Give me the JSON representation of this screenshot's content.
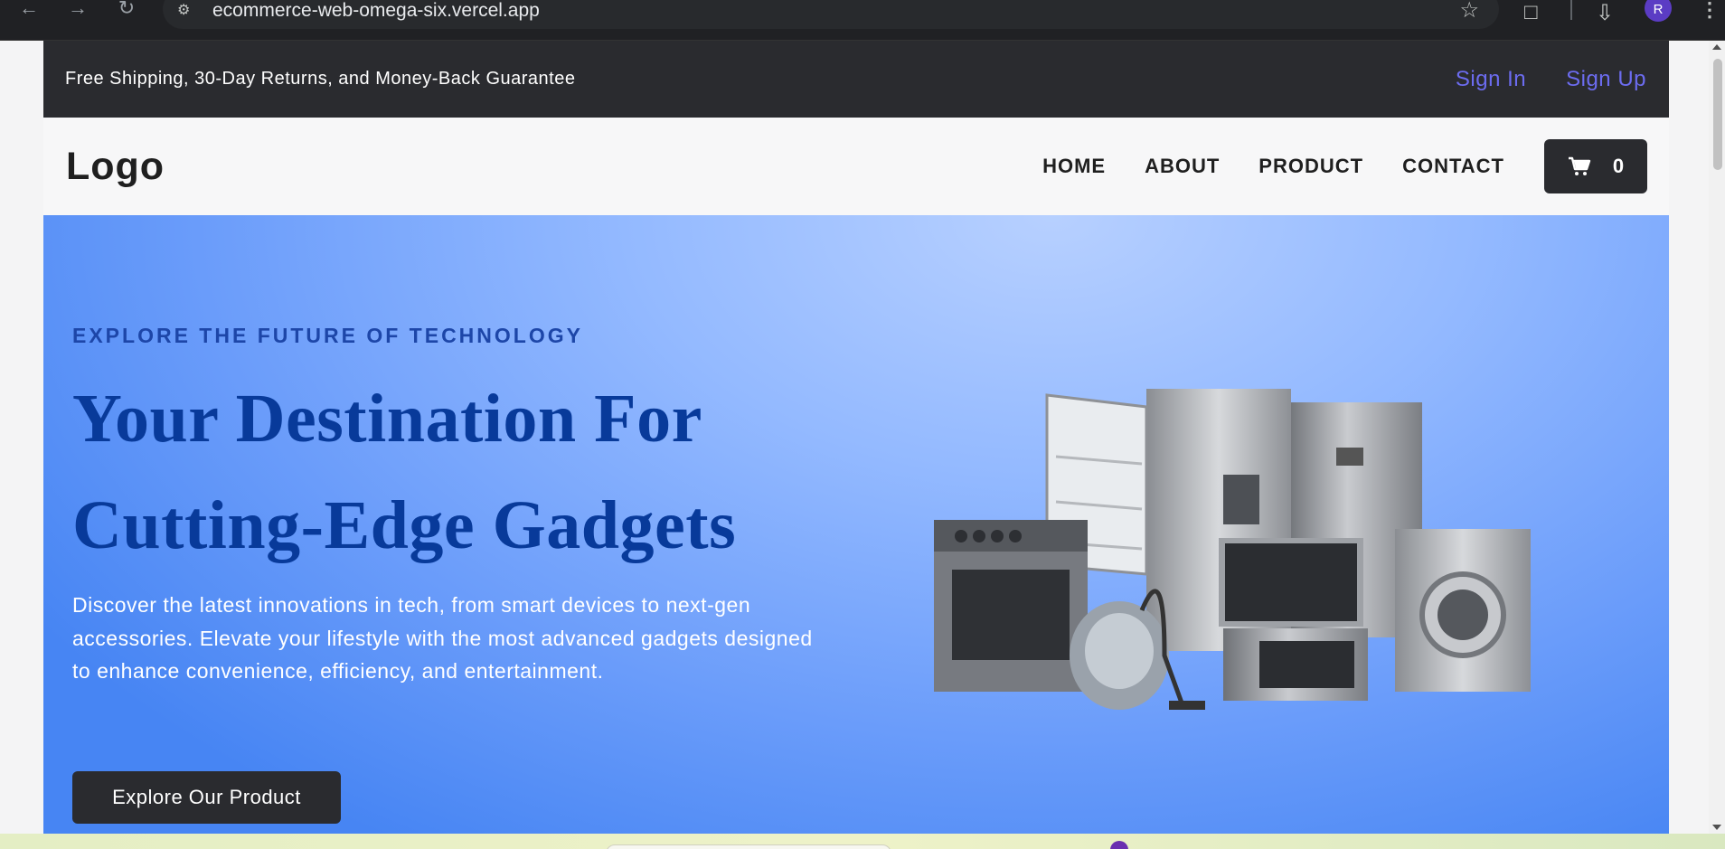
{
  "browser": {
    "url": "ecommerce-web-omega-six.vercel.app",
    "profile_initial": "R",
    "back_icon": "arrow-left-icon",
    "forward_icon": "arrow-right-icon",
    "reload_icon": "reload-icon"
  },
  "topbar": {
    "promo": "Free Shipping, 30-Day Returns, and Money-Back Guarantee",
    "sign_in": "Sign In",
    "sign_up": "Sign Up",
    "link_color": "#6c6cf0"
  },
  "navbar": {
    "logo": "Logo",
    "links": [
      "HOME",
      "ABOUT",
      "PRODUCT",
      "CONTACT"
    ],
    "cart_count": "0"
  },
  "hero": {
    "kicker": "EXPLORE THE FUTURE OF TECHNOLOGY",
    "headline_line1": "Your Destination For",
    "headline_line2": "Cutting-Edge Gadgets",
    "description": "Discover the latest innovations in tech, from smart devices to next-gen accessories. Elevate your lifestyle with the most advanced gadgets designed to enhance convenience, efficiency, and entertainment.",
    "cta": "Explore Our Product",
    "image_alt": "home appliances group",
    "headline_color": "#083a9a"
  }
}
